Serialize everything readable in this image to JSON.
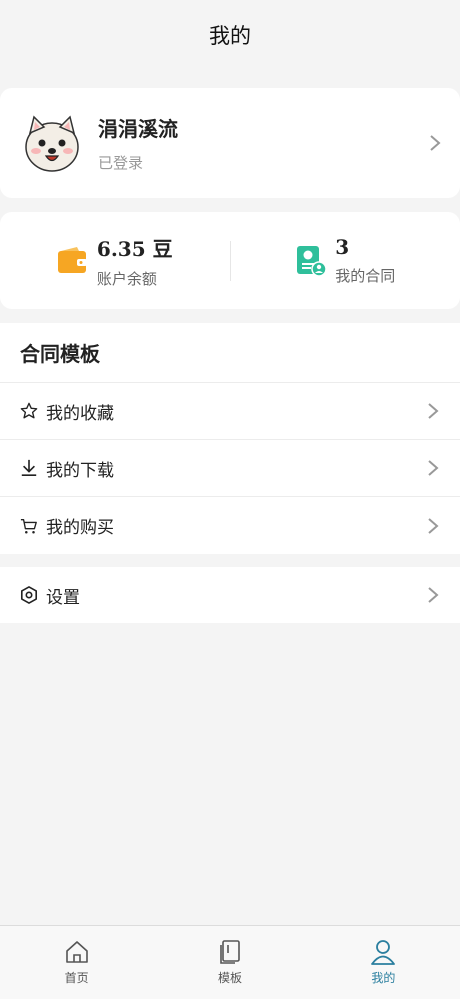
{
  "header": {
    "title": "我的"
  },
  "profile": {
    "name": "涓涓溪流",
    "status": "已登录"
  },
  "stats": {
    "balance": {
      "value": "6.35 豆",
      "label": "账户余额"
    },
    "contracts": {
      "value": "3",
      "label": "我的合同"
    }
  },
  "templates": {
    "title": "合同模板",
    "items": [
      {
        "label": "我的收藏",
        "icon": "star-icon"
      },
      {
        "label": "我的下载",
        "icon": "download-icon"
      },
      {
        "label": "我的购买",
        "icon": "cart-icon"
      }
    ]
  },
  "settings": {
    "label": "设置",
    "icon": "settings-hex-icon"
  },
  "tabbar": {
    "items": [
      {
        "label": "首页",
        "icon": "home-icon"
      },
      {
        "label": "模板",
        "icon": "template-icon"
      },
      {
        "label": "我的",
        "icon": "user-icon",
        "active": true
      }
    ]
  },
  "colors": {
    "accent": "#2b7f9f",
    "wallet": "#f6a623",
    "contract": "#2fbf9b"
  }
}
